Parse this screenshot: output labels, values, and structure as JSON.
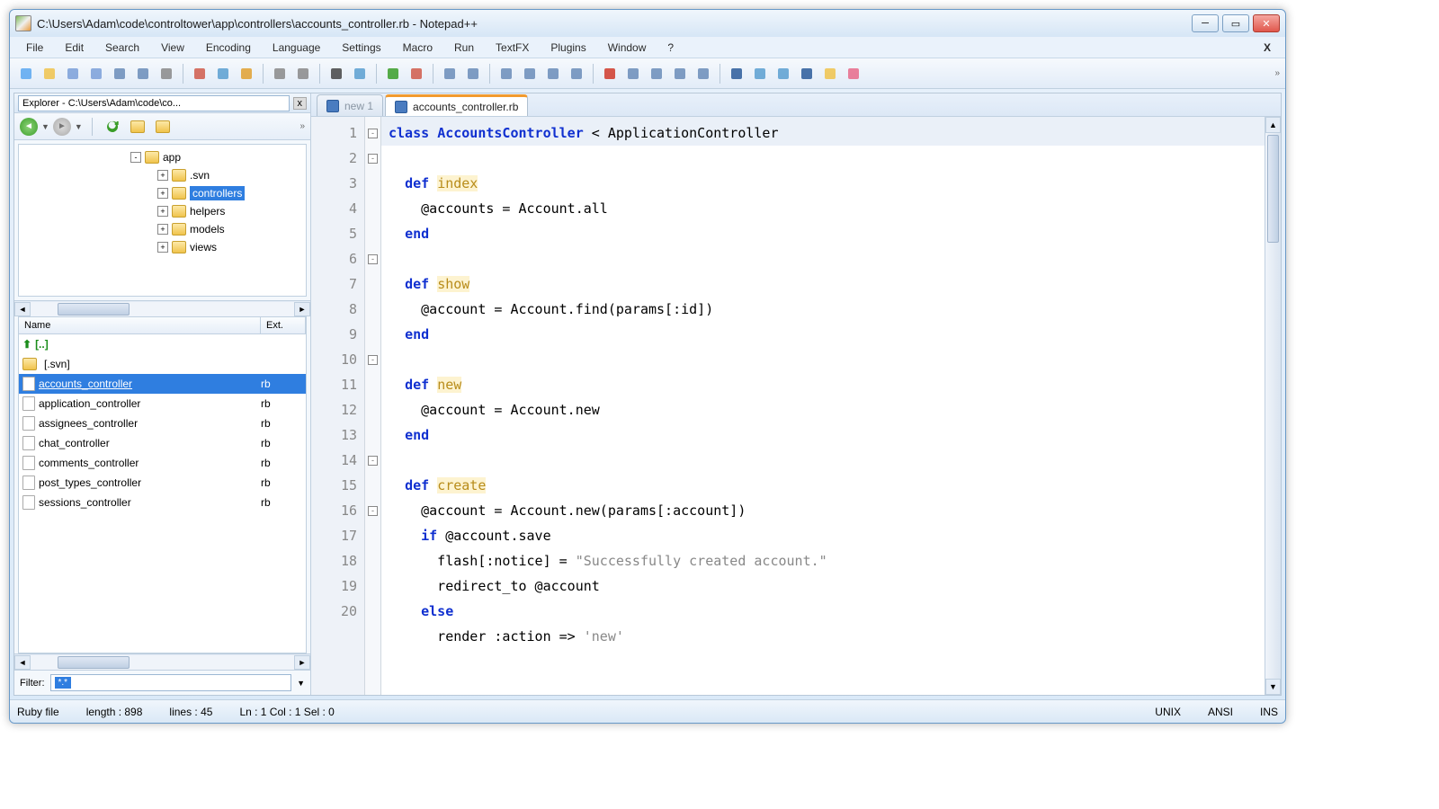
{
  "window": {
    "title": "C:\\Users\\Adam\\code\\controltower\\app\\controllers\\accounts_controller.rb - Notepad++"
  },
  "menu": {
    "items": [
      "File",
      "Edit",
      "Search",
      "View",
      "Encoding",
      "Language",
      "Settings",
      "Macro",
      "Run",
      "TextFX",
      "Plugins",
      "Window",
      "?"
    ],
    "close": "X"
  },
  "explorer": {
    "title": "Explorer - C:\\Users\\Adam\\code\\co...",
    "tree": [
      {
        "indent": 120,
        "toggle": "-",
        "label": "app",
        "selected": false
      },
      {
        "indent": 150,
        "toggle": "+",
        "label": ".svn",
        "selected": false
      },
      {
        "indent": 150,
        "toggle": "+",
        "label": "controllers",
        "selected": true
      },
      {
        "indent": 150,
        "toggle": "+",
        "label": "helpers",
        "selected": false
      },
      {
        "indent": 150,
        "toggle": "+",
        "label": "models",
        "selected": false
      },
      {
        "indent": 150,
        "toggle": "+",
        "label": "views",
        "selected": false
      }
    ],
    "cols": {
      "name": "Name",
      "ext": "Ext."
    },
    "files": [
      {
        "name": "[..]",
        "ext": "",
        "type": "up"
      },
      {
        "name": "[.svn]",
        "ext": "",
        "type": "folder"
      },
      {
        "name": "accounts_controller",
        "ext": "rb",
        "type": "file",
        "selected": true
      },
      {
        "name": "application_controller",
        "ext": "rb",
        "type": "file"
      },
      {
        "name": "assignees_controller",
        "ext": "rb",
        "type": "file"
      },
      {
        "name": "chat_controller",
        "ext": "rb",
        "type": "file"
      },
      {
        "name": "comments_controller",
        "ext": "rb",
        "type": "file"
      },
      {
        "name": "post_types_controller",
        "ext": "rb",
        "type": "file"
      },
      {
        "name": "sessions_controller",
        "ext": "rb",
        "type": "file"
      }
    ],
    "filter_label": "Filter:",
    "filter_value": "*.*"
  },
  "tabs": [
    {
      "label": "new  1",
      "active": false,
      "unsaved": false
    },
    {
      "label": "accounts_controller.rb",
      "active": true,
      "unsaved": false
    }
  ],
  "code": {
    "lines": [
      {
        "n": 1,
        "fold": "-",
        "html": "<span class='kw-class'>class</span> <span class='cls-name'>AccountsController</span> &lt; ApplicationController"
      },
      {
        "n": 2,
        "fold": "-",
        "html": "  <span class='kw-def'>def</span> <span class='method-name'>index</span>"
      },
      {
        "n": 3,
        "fold": "",
        "html": "    @accounts = Account.all"
      },
      {
        "n": 4,
        "fold": "",
        "html": "  <span class='kw-end'>end</span>"
      },
      {
        "n": 5,
        "fold": "",
        "html": ""
      },
      {
        "n": 6,
        "fold": "-",
        "html": "  <span class='kw-def'>def</span> <span class='method-name'>show</span>"
      },
      {
        "n": 7,
        "fold": "",
        "html": "    @account = Account.find(params[:id])"
      },
      {
        "n": 8,
        "fold": "",
        "html": "  <span class='kw-end'>end</span>"
      },
      {
        "n": 9,
        "fold": "",
        "html": ""
      },
      {
        "n": 10,
        "fold": "-",
        "html": "  <span class='kw-def'>def</span> <span class='method-name'>new</span>"
      },
      {
        "n": 11,
        "fold": "",
        "html": "    @account = Account.new"
      },
      {
        "n": 12,
        "fold": "",
        "html": "  <span class='kw-end'>end</span>"
      },
      {
        "n": 13,
        "fold": "",
        "html": ""
      },
      {
        "n": 14,
        "fold": "-",
        "html": "  <span class='kw-def'>def</span> <span class='method-name'>create</span>"
      },
      {
        "n": 15,
        "fold": "",
        "html": "    @account = Account.new(params[:account])"
      },
      {
        "n": 16,
        "fold": "-",
        "html": "    <span class='kw-if'>if</span> @account.save"
      },
      {
        "n": 17,
        "fold": "",
        "html": "      flash[:notice] = <span class='str'>\"Successfully created account.\"</span>"
      },
      {
        "n": 18,
        "fold": "",
        "html": "      redirect_to @account"
      },
      {
        "n": 19,
        "fold": "",
        "html": "    <span class='kw-else'>else</span>"
      },
      {
        "n": 20,
        "fold": "",
        "html": "      render :action =&gt; <span class='str'>'new'</span>"
      }
    ]
  },
  "status": {
    "filetype": "Ruby file",
    "length": "length : 898",
    "lines": "lines : 45",
    "pos": "Ln : 1   Col : 1   Sel : 0",
    "eol": "UNIX",
    "enc": "ANSI",
    "ins": "INS"
  },
  "toolbar_chev": "»",
  "explorer_chev": "»"
}
